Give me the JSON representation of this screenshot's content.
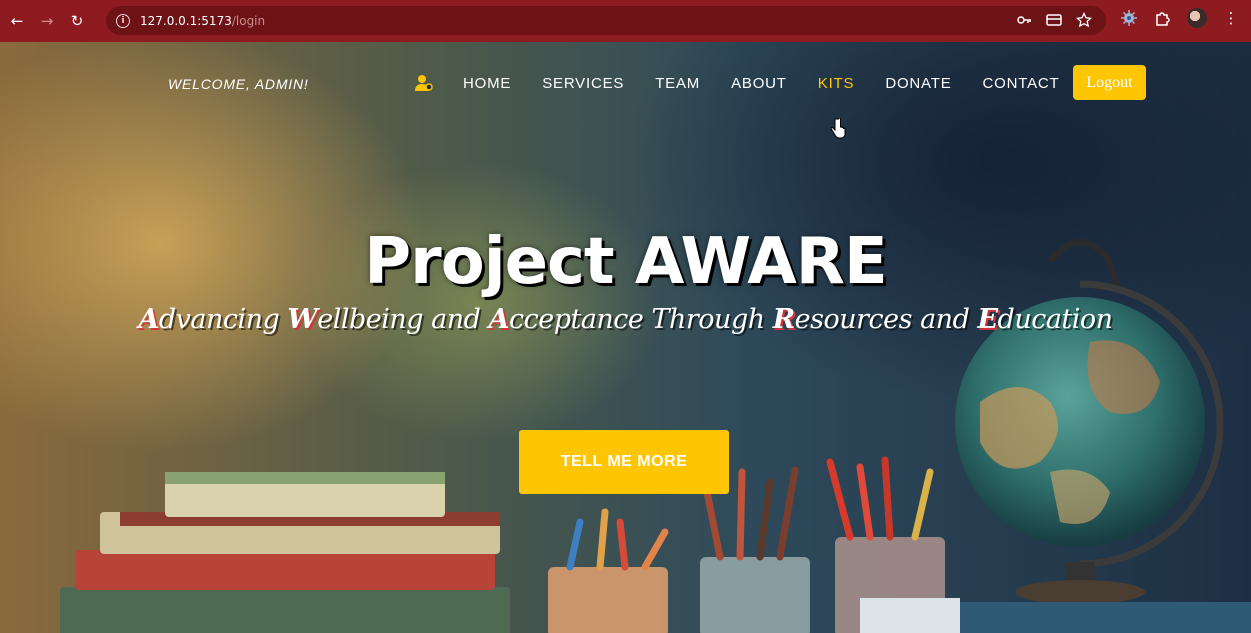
{
  "browser": {
    "url_host": "127.0.0.1:5173",
    "url_path": "/login"
  },
  "nav": {
    "welcome": "WELCOME, ADMIN!",
    "items": [
      {
        "label": "HOME"
      },
      {
        "label": "SERVICES"
      },
      {
        "label": "TEAM"
      },
      {
        "label": "ABOUT"
      },
      {
        "label": "KITS"
      },
      {
        "label": "DONATE"
      },
      {
        "label": "CONTACT"
      }
    ],
    "logout": "Logout"
  },
  "hero": {
    "title": "Project AWARE",
    "subtitle_parts": [
      "A",
      "dvancing ",
      "W",
      "ellbeing and ",
      "A",
      "cceptance Through ",
      "R",
      "esources and ",
      "E",
      "ducation"
    ],
    "cta": "TELL ME MORE"
  },
  "colors": {
    "accent": "#fec503",
    "chrome": "#8e1b1f",
    "highlight_shadow": "#d53336"
  },
  "icons": [
    "back-arrow-icon",
    "forward-arrow-icon",
    "reload-icon",
    "site-info-icon",
    "key-icon",
    "card-icon",
    "star-icon",
    "extension-icon",
    "puzzle-icon",
    "profile-avatar",
    "kebab-menu-icon",
    "user-admin-icon",
    "pointer-cursor-icon"
  ]
}
